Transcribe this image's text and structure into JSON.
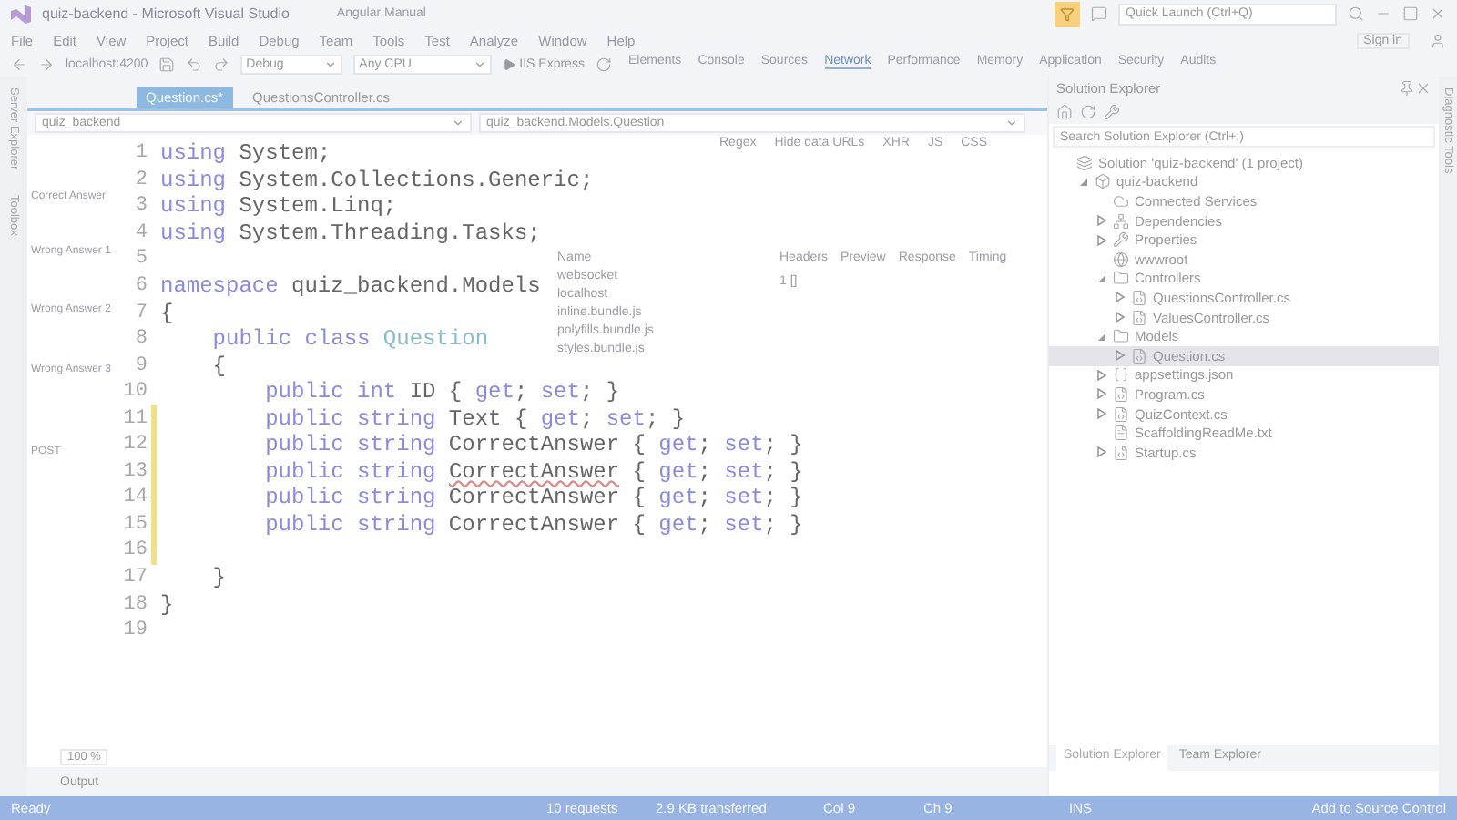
{
  "window": {
    "title": "quiz-backend - Microsoft Visual Studio",
    "ghost_tab": "Angular Manual",
    "quick_launch": {
      "placeholder": "Quick Launch (Ctrl+Q)"
    }
  },
  "menu": [
    "File",
    "Edit",
    "View",
    "Project",
    "Build",
    "Debug",
    "Team",
    "Tools",
    "Test",
    "Analyze",
    "Window",
    "Help"
  ],
  "sign_in": "Sign in",
  "toolbar": {
    "configuration": "Debug",
    "platform": "Any CPU",
    "run": "IIS Express",
    "ghost_address": "localhost:4200"
  },
  "side_tabs": [
    "Server Explorer",
    "Toolbox"
  ],
  "editor": {
    "tabs": [
      {
        "label": "Question.cs*",
        "selected": true
      },
      {
        "label": "QuestionsController.cs",
        "selected": false
      }
    ],
    "project": "quiz_backend",
    "scope": "quiz_backend.Models.Question",
    "lines": [
      {
        "number": "1",
        "modified": false,
        "tokens": [
          {
            "kind": "kw",
            "text": "using"
          },
          {
            "kind": "plain",
            "text": " System;"
          }
        ]
      },
      {
        "number": "2",
        "modified": false,
        "tokens": [
          {
            "kind": "kw",
            "text": "using"
          },
          {
            "kind": "plain",
            "text": " System.Collections.Generic;"
          }
        ]
      },
      {
        "number": "3",
        "modified": false,
        "tokens": [
          {
            "kind": "kw",
            "text": "using"
          },
          {
            "kind": "plain",
            "text": " System.Linq;"
          }
        ]
      },
      {
        "number": "4",
        "modified": false,
        "tokens": [
          {
            "kind": "kw",
            "text": "using"
          },
          {
            "kind": "plain",
            "text": " System.Threading.Tasks;"
          }
        ]
      },
      {
        "number": "5",
        "modified": false
      },
      {
        "number": "6",
        "modified": false,
        "tokens": [
          {
            "kind": "kw",
            "text": "namespace"
          },
          {
            "kind": "plain",
            "text": " quiz_backend.Models"
          }
        ]
      },
      {
        "number": "7",
        "modified": false,
        "tokens": [
          {
            "kind": "plain",
            "text": "{"
          }
        ]
      },
      {
        "number": "8",
        "modified": false,
        "tokens": [
          {
            "kind": "kw",
            "text": "    public class"
          },
          {
            "kind": "type",
            "text": " Question"
          }
        ]
      },
      {
        "number": "9",
        "modified": false,
        "tokens": [
          {
            "kind": "plain",
            "text": "    {"
          }
        ]
      },
      {
        "number": "10",
        "modified": false,
        "tokens": [
          {
            "kind": "kw",
            "text": "        public int"
          },
          {
            "kind": "plain",
            "text": " ID { "
          },
          {
            "kind": "kw",
            "text": "get"
          },
          {
            "kind": "plain",
            "text": "; "
          },
          {
            "kind": "kw",
            "text": "set"
          },
          {
            "kind": "plain",
            "text": "; }"
          }
        ]
      },
      {
        "number": "11",
        "modified": true,
        "tokens": [
          {
            "kind": "kw",
            "text": "        public string"
          },
          {
            "kind": "plain",
            "text": " Text { "
          },
          {
            "kind": "kw",
            "text": "get"
          },
          {
            "kind": "plain",
            "text": "; "
          },
          {
            "kind": "kw",
            "text": "set"
          },
          {
            "kind": "plain",
            "text": "; }"
          }
        ]
      },
      {
        "number": "12",
        "modified": true,
        "tokens": [
          {
            "kind": "kw",
            "text": "        public string"
          },
          {
            "kind": "plain",
            "text": " CorrectAnswer { "
          },
          {
            "kind": "kw",
            "text": "get"
          },
          {
            "kind": "plain",
            "text": "; "
          },
          {
            "kind": "kw",
            "text": "set"
          },
          {
            "kind": "plain",
            "text": "; }"
          }
        ]
      },
      {
        "number": "13",
        "modified": true,
        "tokens": [
          {
            "kind": "kw",
            "text": "        public string "
          },
          {
            "kind": "error",
            "text": "CorrectAnswer"
          },
          {
            "kind": "plain",
            "text": " { "
          },
          {
            "kind": "kw",
            "text": "get"
          },
          {
            "kind": "plain",
            "text": "; "
          },
          {
            "kind": "kw",
            "text": "set"
          },
          {
            "kind": "plain",
            "text": "; }"
          }
        ]
      },
      {
        "number": "14",
        "modified": true,
        "tokens": [
          {
            "kind": "kw",
            "text": "        public string"
          },
          {
            "kind": "plain",
            "text": " CorrectAnswer { "
          },
          {
            "kind": "kw",
            "text": "get"
          },
          {
            "kind": "plain",
            "text": "; "
          },
          {
            "kind": "kw",
            "text": "set"
          },
          {
            "kind": "plain",
            "text": "; }"
          }
        ]
      },
      {
        "number": "15",
        "modified": true,
        "tokens": [
          {
            "kind": "kw",
            "text": "        public string"
          },
          {
            "kind": "plain",
            "text": " CorrectAnswer { "
          },
          {
            "kind": "kw",
            "text": "get"
          },
          {
            "kind": "plain",
            "text": "; "
          },
          {
            "kind": "kw",
            "text": "set"
          },
          {
            "kind": "plain",
            "text": "; }"
          }
        ]
      },
      {
        "number": "16",
        "modified": true
      },
      {
        "number": "17",
        "modified": false,
        "tokens": [
          {
            "kind": "plain",
            "text": "    }"
          }
        ]
      },
      {
        "number": "18",
        "modified": false,
        "tokens": [
          {
            "kind": "plain",
            "text": "}"
          }
        ]
      },
      {
        "number": "19",
        "modified": false
      }
    ],
    "zoom": "100 %"
  },
  "output_label": "Output",
  "ghost_form": [
    "Correct Answer",
    "Wrong Answer 1",
    "Wrong Answer 2",
    "Wrong Answer 3",
    "POST"
  ],
  "devtools": {
    "tabs": [
      {
        "label": "Elements",
        "selected": false
      },
      {
        "label": "Console",
        "selected": false
      },
      {
        "label": "Sources",
        "selected": false
      },
      {
        "label": "Network",
        "selected": true
      },
      {
        "label": "Performance",
        "selected": false
      },
      {
        "label": "Memory",
        "selected": false
      },
      {
        "label": "Application",
        "selected": false
      },
      {
        "label": "Security",
        "selected": false
      },
      {
        "label": "Audits",
        "selected": false
      }
    ],
    "filters": [
      "Regex",
      "Hide data URLs",
      "XHR",
      "JS",
      "CSS"
    ],
    "name_header": "Name",
    "requests": [
      "websocket",
      "localhost",
      "inline.bundle.js",
      "polyfills.bundle.js",
      "styles.bundle.js"
    ],
    "detail_tabs": [
      "Headers",
      "Preview",
      "Response",
      "Timing"
    ],
    "response": "1 []"
  },
  "solution_explorer": {
    "title": "Solution Explorer",
    "search": {
      "placeholder": "Search Solution Explorer (Ctrl+;)"
    },
    "tree": [
      {
        "label": "Solution 'quiz-backend' (1 project)",
        "kind": "solution",
        "selected": false,
        "children": [
          {
            "label": "quiz-backend",
            "kind": "project",
            "selected": false,
            "expanded": true,
            "children": [
              {
                "label": "Connected Services",
                "kind": "connected",
                "selected": false
              },
              {
                "label": "Dependencies",
                "kind": "deps",
                "selected": false,
                "expanded": false
              },
              {
                "label": "Properties",
                "kind": "wrench",
                "selected": false,
                "expanded": false
              },
              {
                "label": "wwwroot",
                "kind": "globe",
                "selected": false
              },
              {
                "label": "Controllers",
                "kind": "folder",
                "selected": false,
                "expanded": true,
                "children": [
                  {
                    "label": "QuestionsController.cs",
                    "kind": "cs",
                    "selected": false,
                    "expanded": false
                  },
                  {
                    "label": "ValuesController.cs",
                    "kind": "cs",
                    "selected": false,
                    "expanded": false
                  }
                ]
              },
              {
                "label": "Models",
                "kind": "folder",
                "selected": false,
                "expanded": true,
                "children": [
                  {
                    "label": "Question.cs",
                    "kind": "cs",
                    "selected": true,
                    "expanded": false
                  }
                ]
              },
              {
                "label": "appsettings.json",
                "kind": "json",
                "selected": false,
                "expanded": false
              },
              {
                "label": "Program.cs",
                "kind": "cs",
                "selected": false,
                "expanded": false
              },
              {
                "label": "QuizContext.cs",
                "kind": "cs",
                "selected": false,
                "expanded": false
              },
              {
                "label": "ScaffoldingReadMe.txt",
                "kind": "txt",
                "selected": false
              },
              {
                "label": "Startup.cs",
                "kind": "cs",
                "selected": false,
                "expanded": false
              }
            ]
          }
        ]
      }
    ],
    "bottom_tabs": [
      {
        "label": "Solution Explorer",
        "selected": true
      },
      {
        "label": "Team Explorer",
        "selected": false
      }
    ]
  },
  "right_tabs": [
    "Diagnostic Tools"
  ],
  "status_bar": {
    "state": "Ready",
    "requests": "10 requests",
    "transferred": "2.9 KB transferred",
    "col": "Col 9",
    "ch": "Ch 9",
    "mode": "INS",
    "source_control": "Add to Source Control"
  }
}
